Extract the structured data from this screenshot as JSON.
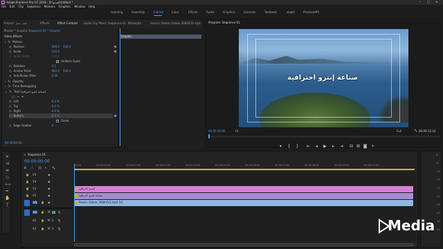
{
  "window": {
    "title": "Adobe Premiere Pro CC 2019 - D:\\فيديو\\Untitled *"
  },
  "menu": [
    "File",
    "Edit",
    "Clip",
    "Sequence",
    "Markers",
    "Graphics",
    "Window",
    "Help"
  ],
  "workspaces": [
    "Learning",
    "Assembly",
    "Editing",
    "Color",
    "Effects",
    "Audio",
    "Graphics",
    "Libraries",
    "Textbook",
    "waqih",
    "Premiere99"
  ],
  "source_panel": {
    "tabs": [
      "Project: ملف عمل",
      "Effects",
      "Effect Controls",
      "Audio Clip Mixer: Sequence 01",
      "Metadata",
      "Source: Pexels Videos 3084433.mp4"
    ],
    "master_label": "Master * Graphic",
    "sequence_label": "Sequence 01 * Graphic",
    "section_video_effects": "Video Effects",
    "timeline_clip_label": "Graphic",
    "rows": {
      "motion": "Motion",
      "position": {
        "label": "Position",
        "v1": "960.0",
        "v2": "540.0"
      },
      "scale": {
        "label": "Scale",
        "v1": "100.0"
      },
      "scale_width": {
        "label": "Scale Width",
        "v1": "100.0"
      },
      "uniform_scale": "Uniform Scale",
      "rotation": {
        "label": "Rotation",
        "v1": "0.0"
      },
      "anchor_point": {
        "label": "Anchor Point",
        "v1": "960.0",
        "v2": "540.0"
      },
      "anti_flicker": {
        "label": "Anti-flicker Filter",
        "v1": "0.00"
      },
      "opacity": "Opacity",
      "time_remapping": "Time Remapping",
      "text_layer": "Text (صناعة إنترو احترافية)",
      "left": {
        "label": "Left",
        "v1": "0.0 %"
      },
      "top": {
        "label": "Top",
        "v1": "0.0 %"
      },
      "right": {
        "label": "Right",
        "v1": "0.0 %"
      },
      "bottom": {
        "label": "Bottom",
        "v1": "0.0 %"
      },
      "zoom": "Zoom",
      "edge_feather": {
        "label": "Edge Feather",
        "v1": "0"
      }
    },
    "current_time": "00:00:00:00"
  },
  "program_monitor": {
    "title": "Program: Sequence 01",
    "overlay_text": "صناعة إنترو احترافية",
    "timecode_left": "00:00:00:00",
    "fit": "Fit",
    "quality": "Full",
    "timecode_right": "00:00:12:10",
    "transport": [
      "marker-icon",
      "in-point-icon",
      "out-point-icon",
      "go-to-in-icon",
      "step-back-icon",
      "play-icon",
      "step-forward-icon",
      "go-to-out-icon",
      "insert-icon",
      "overwrite-icon",
      "camera-icon",
      "add-icon"
    ]
  },
  "timeline": {
    "tab": "Sequence 01",
    "timecode": "00:00:00:00",
    "ruler": [
      "00:00",
      "00:00:01:00",
      "00:00:02:00",
      "00:00:03:00",
      "00:00:04:00",
      "00:00:05:00",
      "00:00:06:00",
      "00:00:07:00",
      "00:00:08:00",
      "00:00:09:00",
      "00:00:10:00"
    ],
    "video_tracks": [
      "V5",
      "V4",
      "V3",
      "V2",
      "V1"
    ],
    "audio_tracks": [
      "A1",
      "A2",
      "A3"
    ],
    "clips": {
      "v3": "انتيرو احترافي",
      "v2": "صناعة إنترو احترافية",
      "v1": "Pexels Videos 3084433.mp4 [V]"
    }
  },
  "audio_meter": {
    "labels": [
      "0",
      "-6",
      "-12",
      "-18",
      "-24",
      "-30",
      "-36",
      "-42",
      "-48",
      "-54"
    ]
  },
  "watermark": {
    "text": "Media"
  },
  "colors": {
    "accent": "#2d8ceb",
    "clip_pink": "#d67fd6",
    "clip_purple": "#a78bd4",
    "clip_blue": "#90b8e0",
    "playhead": "#4a9cf0"
  }
}
